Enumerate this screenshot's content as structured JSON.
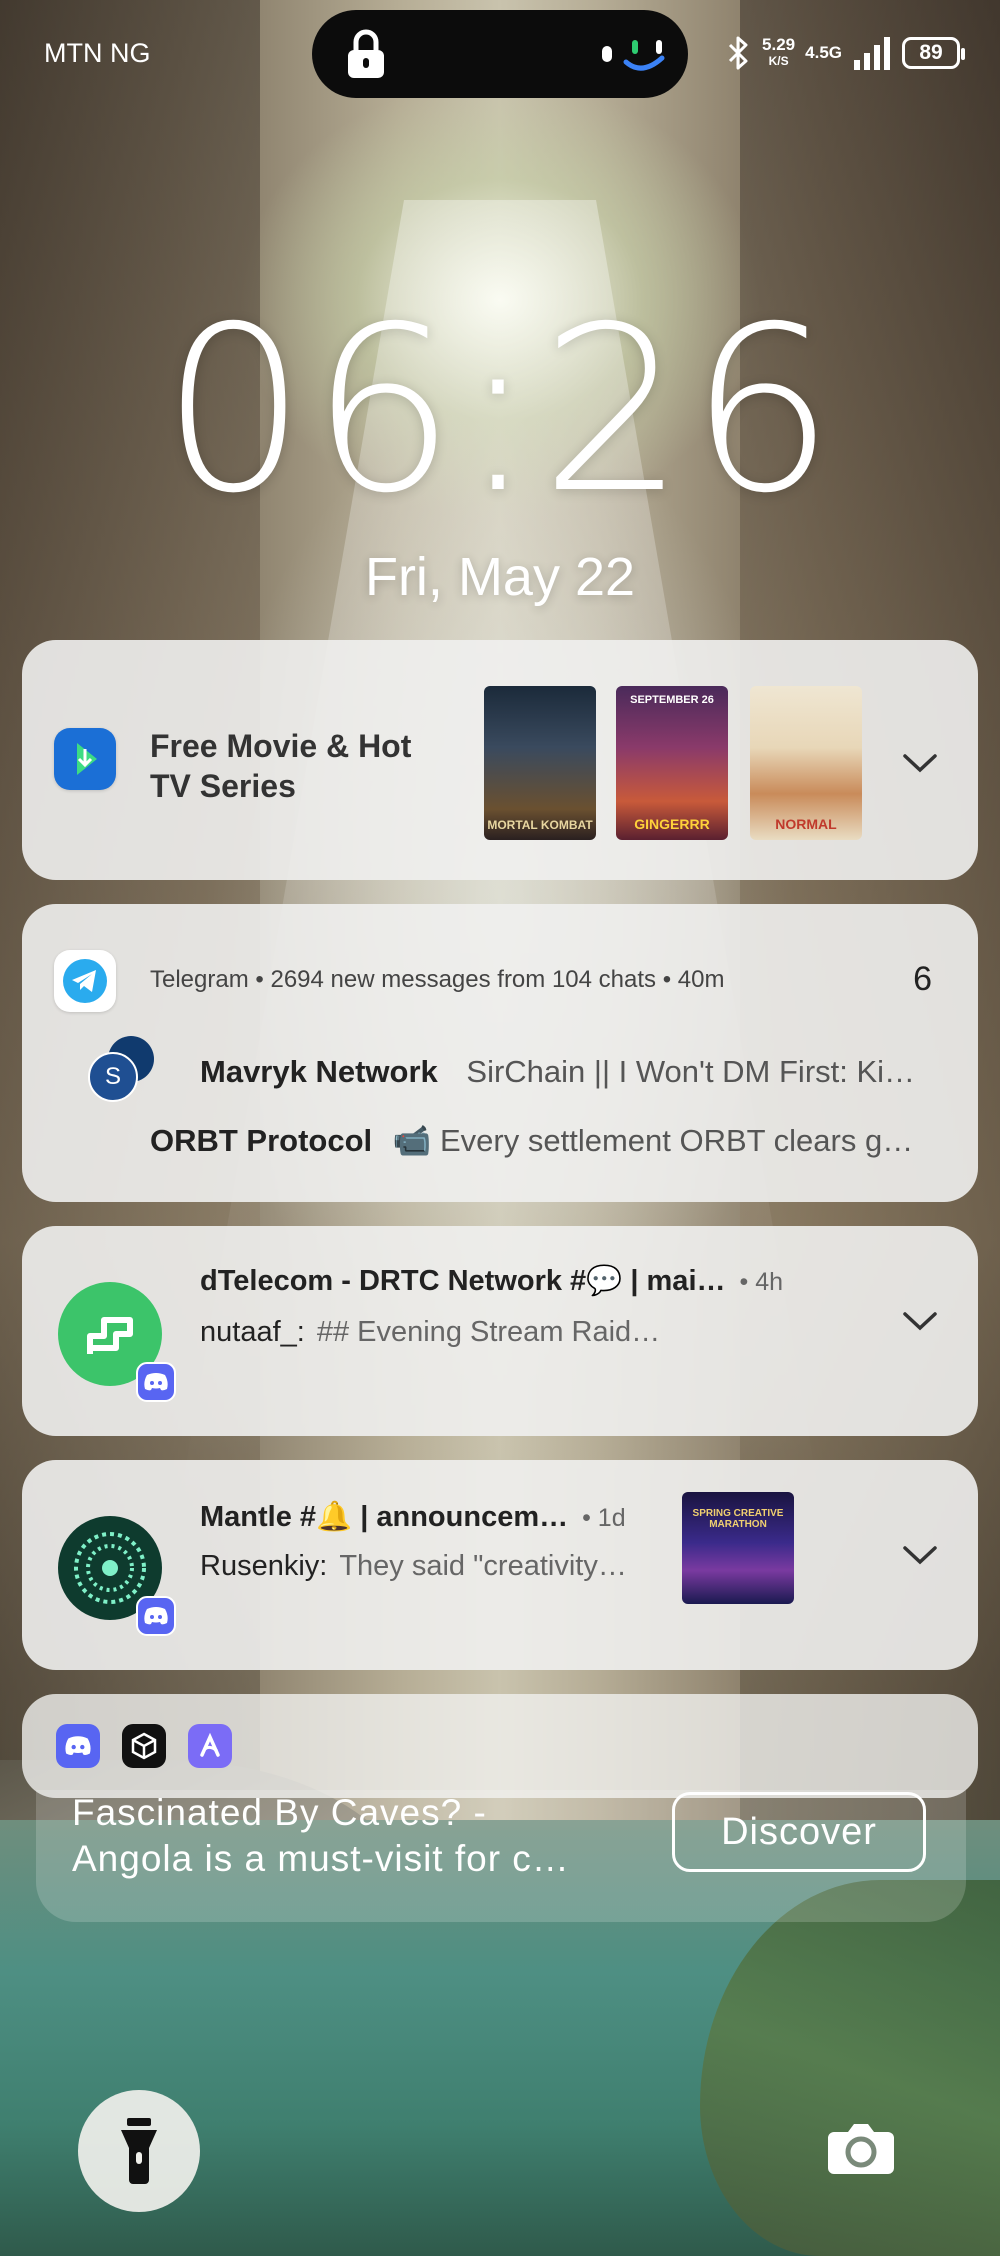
{
  "status_bar": {
    "carrier": "MTN NG",
    "speed_value": "5.29",
    "speed_unit": "K/S",
    "network": "4.5G",
    "battery": "89"
  },
  "lock_screen": {
    "time": "06:26",
    "date": "Fri, May 22"
  },
  "notifications": {
    "movie": {
      "title_line1": "Free Movie & Hot",
      "title_line2": "TV Series",
      "icon_label": "Free Movie",
      "posters": [
        "MORTAL KOMBAT",
        "GINGERRR",
        "NORMAL"
      ],
      "poster2_top": "SEPTEMBER 26"
    },
    "telegram": {
      "app": "Telegram",
      "summary": "2694 new messages from 104 chats",
      "time": "40m",
      "count": "6",
      "avatar_letter": "S",
      "row1_sender": "Mavryk Network",
      "row1_message": "SirChain || I Won't DM First: Ki…",
      "row2_sender": "ORBT Protocol",
      "row2_message": "📹 Every settlement ORBT clears g…"
    },
    "dtelecom": {
      "title": "dTelecom - DRTC Network #💬 | mai…",
      "time": "• 4h",
      "sender": "nutaaf_:",
      "message": "## Evening Stream Raid…"
    },
    "mantle": {
      "title": "Mantle #🔔 | announcem…",
      "time": "• 1d",
      "sender": "Rusenkiy:",
      "message": "They said \"creativity…",
      "thumb_label": "SPRING CREATIVE MARATHON"
    }
  },
  "ad": {
    "line1": "Fascinated By Caves? -",
    "line2": "Angola is a must-visit for c…",
    "button": "Discover"
  },
  "colors": {
    "discord": "#5865F2",
    "telegram": "#2AABEE",
    "dtelecom": "#3CC46A",
    "mantle": "#0E3B2E"
  }
}
